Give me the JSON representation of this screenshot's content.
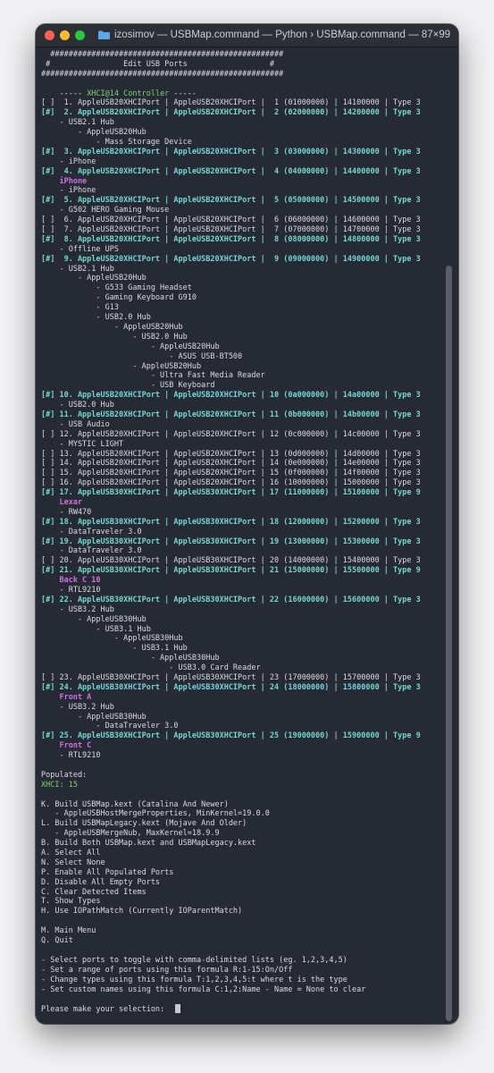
{
  "window": {
    "title": "izosimov — USBMap.command — Python › USBMap.command — 87×99"
  },
  "lines": [
    {
      "t": "  ###################################################"
    },
    {
      "t": " #                Edit USB Ports                  #"
    },
    {
      "t": "#####################################################"
    },
    {
      "t": ""
    },
    {
      "t": "    ----- ",
      "s": [
        {
          "t": "XHCI@14 Controller",
          "c": "grn"
        },
        {
          "t": " -----"
        }
      ]
    },
    {
      "t": "[ ]  1. AppleUSB20XHCIPort | AppleUSB20XHCIPort |  1 (01000000) | 14100000 | Type 3"
    },
    {
      "t": "[#]  2. AppleUSB20XHCIPort | AppleUSB20XHCIPort |  2 (02000000) | 14200000 | Type 3",
      "c": "hl"
    },
    {
      "t": "    - USB2.1 Hub"
    },
    {
      "t": "        - AppleUSB20Hub"
    },
    {
      "t": "            - Mass Storage Device"
    },
    {
      "t": "[#]  3. AppleUSB20XHCIPort | AppleUSB20XHCIPort |  3 (03000000) | 14300000 | Type 3",
      "c": "hl"
    },
    {
      "t": "    - iPhone"
    },
    {
      "t": "[#]  4. AppleUSB20XHCIPort | AppleUSB20XHCIPort |  4 (04000000) | 14400000 | Type 3",
      "c": "hl"
    },
    {
      "t": "    iPhone",
      "c": "mag"
    },
    {
      "t": "    - iPhone"
    },
    {
      "t": "[#]  5. AppleUSB20XHCIPort | AppleUSB20XHCIPort |  5 (05000000) | 14500000 | Type 3",
      "c": "hl"
    },
    {
      "t": "    - G502 HERO Gaming Mouse"
    },
    {
      "t": "[ ]  6. AppleUSB20XHCIPort | AppleUSB20XHCIPort |  6 (06000000) | 14600000 | Type 3"
    },
    {
      "t": "[ ]  7. AppleUSB20XHCIPort | AppleUSB20XHCIPort |  7 (07000000) | 14700000 | Type 3"
    },
    {
      "t": "[#]  8. AppleUSB20XHCIPort | AppleUSB20XHCIPort |  8 (08000000) | 14800000 | Type 3",
      "c": "hl"
    },
    {
      "t": "    - Offline UPS"
    },
    {
      "t": "[#]  9. AppleUSB20XHCIPort | AppleUSB20XHCIPort |  9 (09000000) | 14900000 | Type 3",
      "c": "hl"
    },
    {
      "t": "    - USB2.1 Hub"
    },
    {
      "t": "        - AppleUSB20Hub"
    },
    {
      "t": "            - G533 Gaming Headset"
    },
    {
      "t": "            - Gaming Keyboard G910"
    },
    {
      "t": "            - G13"
    },
    {
      "t": "            - USB2.0 Hub"
    },
    {
      "t": "                - AppleUSB20Hub"
    },
    {
      "t": "                    - USB2.0 Hub"
    },
    {
      "t": "                        - AppleUSB20Hub"
    },
    {
      "t": "                            - ASUS USB-BT500"
    },
    {
      "t": "                    - AppleUSB20Hub"
    },
    {
      "t": "                        - Ultra Fast Media Reader"
    },
    {
      "t": "                        - USB Keyboard"
    },
    {
      "t": "[#] 10. AppleUSB20XHCIPort | AppleUSB20XHCIPort | 10 (0a000000) | 14a00000 | Type 3",
      "c": "hl"
    },
    {
      "t": "    - USB2.0 Hub"
    },
    {
      "t": "[#] 11. AppleUSB20XHCIPort | AppleUSB20XHCIPort | 11 (0b000000) | 14b00000 | Type 3",
      "c": "hl"
    },
    {
      "t": "    - USB Audio"
    },
    {
      "t": "[ ] 12. AppleUSB20XHCIPort | AppleUSB20XHCIPort | 12 (0c000000) | 14c00000 | Type 3"
    },
    {
      "t": "    - MYSTIC LIGHT"
    },
    {
      "t": "[ ] 13. AppleUSB20XHCIPort | AppleUSB20XHCIPort | 13 (0d000000) | 14d00000 | Type 3"
    },
    {
      "t": "[ ] 14. AppleUSB20XHCIPort | AppleUSB20XHCIPort | 14 (0e000000) | 14e00000 | Type 3"
    },
    {
      "t": "[ ] 15. AppleUSB20XHCIPort | AppleUSB20XHCIPort | 15 (0f000000) | 14f00000 | Type 3"
    },
    {
      "t": "[ ] 16. AppleUSB20XHCIPort | AppleUSB20XHCIPort | 16 (10000000) | 15000000 | Type 3"
    },
    {
      "t": "[#] 17. AppleUSB30XHCIPort | AppleUSB30XHCIPort | 17 (11000000) | 15100000 | Type 9",
      "c": "hl"
    },
    {
      "t": "    Lexar",
      "c": "mag"
    },
    {
      "t": "    - RW470"
    },
    {
      "t": "[#] 18. AppleUSB30XHCIPort | AppleUSB30XHCIPort | 18 (12000000) | 15200000 | Type 3",
      "c": "hl"
    },
    {
      "t": "    - DataTraveler 3.0"
    },
    {
      "t": "[#] 19. AppleUSB30XHCIPort | AppleUSB30XHCIPort | 19 (13000000) | 15300000 | Type 3",
      "c": "hl"
    },
    {
      "t": "    - DataTraveler 3.0"
    },
    {
      "t": "[ ] 20. AppleUSB30XHCIPort | AppleUSB30XHCIPort | 20 (14000000) | 15400000 | Type 3"
    },
    {
      "t": "[#] 21. AppleUSB30XHCIPort | AppleUSB30XHCIPort | 21 (15000000) | 15500000 | Type 9",
      "c": "hl"
    },
    {
      "t": "    Back C 10",
      "c": "mag"
    },
    {
      "t": "    - RTL9210"
    },
    {
      "t": "[#] 22. AppleUSB30XHCIPort | AppleUSB30XHCIPort | 22 (16000000) | 15600000 | Type 3",
      "c": "hl"
    },
    {
      "t": "    - USB3.2 Hub"
    },
    {
      "t": "        - AppleUSB30Hub"
    },
    {
      "t": "            - USB3.1 Hub"
    },
    {
      "t": "                - AppleUSB30Hub"
    },
    {
      "t": "                    - USB3.1 Hub"
    },
    {
      "t": "                        - AppleUSB30Hub"
    },
    {
      "t": "                            - USB3.0 Card Reader"
    },
    {
      "t": "[ ] 23. AppleUSB30XHCIPort | AppleUSB30XHCIPort | 23 (17000000) | 15700000 | Type 3"
    },
    {
      "t": "[#] 24. AppleUSB30XHCIPort | AppleUSB30XHCIPort | 24 (18000000) | 15800000 | Type 3",
      "c": "hl"
    },
    {
      "t": "    Front A",
      "c": "mag"
    },
    {
      "t": "    - USB3.2 Hub"
    },
    {
      "t": "        - AppleUSB30Hub"
    },
    {
      "t": "            - DataTraveler 3.0"
    },
    {
      "t": "[#] 25. AppleUSB30XHCIPort | AppleUSB30XHCIPort | 25 (19000000) | 15900000 | Type 9",
      "c": "hl"
    },
    {
      "t": "    Front C",
      "c": "mag"
    },
    {
      "t": "    - RTL9210"
    },
    {
      "t": ""
    },
    {
      "t": "Populated:"
    },
    {
      "t": "XHCI: 15",
      "c": "grn"
    },
    {
      "t": ""
    },
    {
      "t": "K. Build USBMap.kext (Catalina And Newer)"
    },
    {
      "t": "   - AppleUSBHostMergeProperties, MinKernel=19.0.0"
    },
    {
      "t": "L. Build USBMapLegacy.kext (Mojave And Older)"
    },
    {
      "t": "   - AppleUSBMergeNub, MaxKernel=18.9.9"
    },
    {
      "t": "B. Build Both USBMap.kext and USBMapLegacy.kext"
    },
    {
      "t": "A. Select All"
    },
    {
      "t": "N. Select None"
    },
    {
      "t": "P. Enable All Populated Ports"
    },
    {
      "t": "D. Disable All Empty Ports"
    },
    {
      "t": "C. Clear Detected Items"
    },
    {
      "t": "T. Show Types"
    },
    {
      "t": "H. Use IOPathMatch (Currently IOParentMatch)"
    },
    {
      "t": ""
    },
    {
      "t": "M. Main Menu"
    },
    {
      "t": "Q. Quit"
    },
    {
      "t": ""
    },
    {
      "t": "- Select ports to toggle with comma-delimited lists (eg. 1,2,3,4,5)"
    },
    {
      "t": "- Set a range of ports using this formula R:1-15:On/Off"
    },
    {
      "t": "- Change types using this formula T:1,2,3,4,5:t where t is the type"
    },
    {
      "t": "- Set custom names using this formula C:1,2:Name - Name = None to clear"
    },
    {
      "t": ""
    },
    {
      "t": "Please make your selection:  ",
      "cursor": true
    }
  ]
}
